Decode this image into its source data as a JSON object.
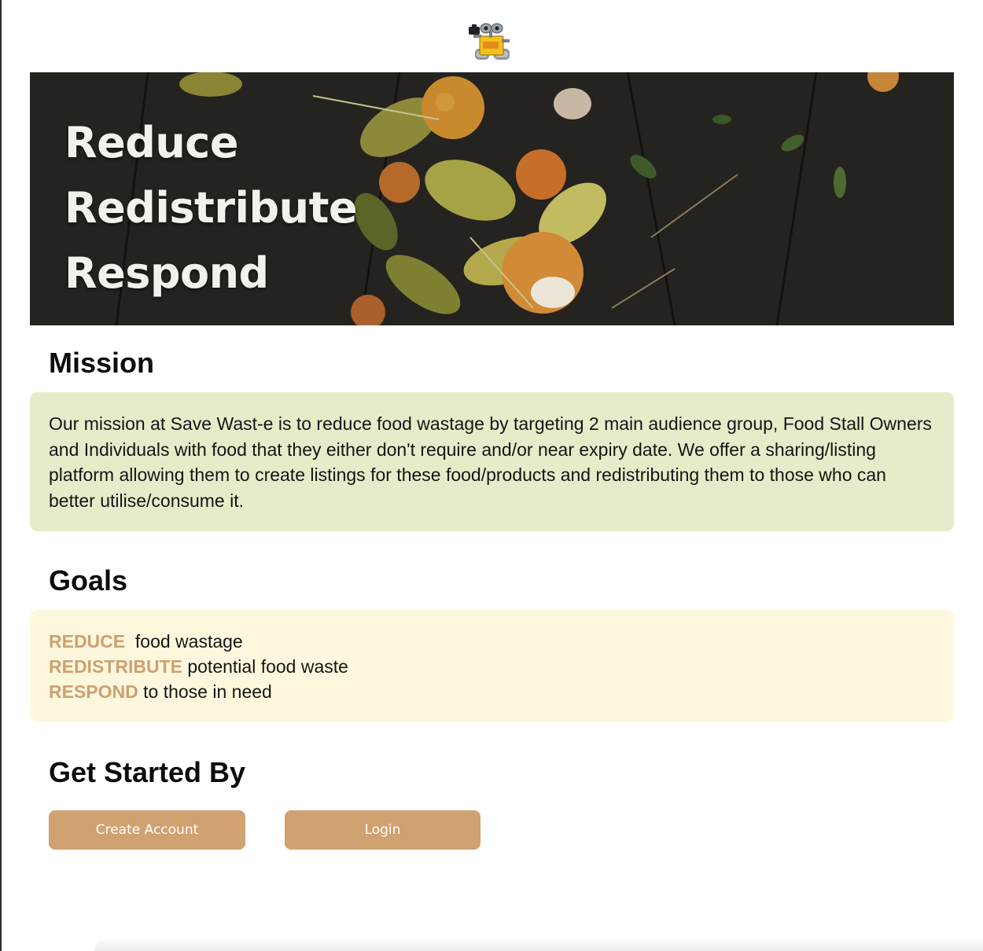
{
  "logo": {
    "icon": "robot-mascot-icon"
  },
  "hero": {
    "lines": [
      "Reduce",
      "Redistribute",
      "Respond"
    ],
    "image": "rotting-fruit-and-leaves-photo"
  },
  "mission": {
    "title": "Mission",
    "text": "Our mission at Save Wast-e is to reduce food wastage by targeting 2 main audience group, Food Stall Owners and Individuals with food that they either don't require and/or near expiry date. We offer a sharing/listing platform allowing them to create listings for these food/products and redistributing them to those who can better utilise/consume it."
  },
  "goals": {
    "title": "Goals",
    "items": [
      {
        "key": "REDUCE",
        "text": " food wastage"
      },
      {
        "key": "REDISTRIBUTE",
        "text": "potential food waste"
      },
      {
        "key": "RESPOND",
        "text": "to those in need"
      }
    ]
  },
  "get_started": {
    "title": "Get Started By",
    "create_account_label": "Create Account",
    "login_label": "Login"
  },
  "colors": {
    "accent": "#d0a271",
    "goal_keyword": "#cfa06f",
    "mission_bg": "#e5ecc9",
    "goals_bg": "#fdf8dd"
  }
}
